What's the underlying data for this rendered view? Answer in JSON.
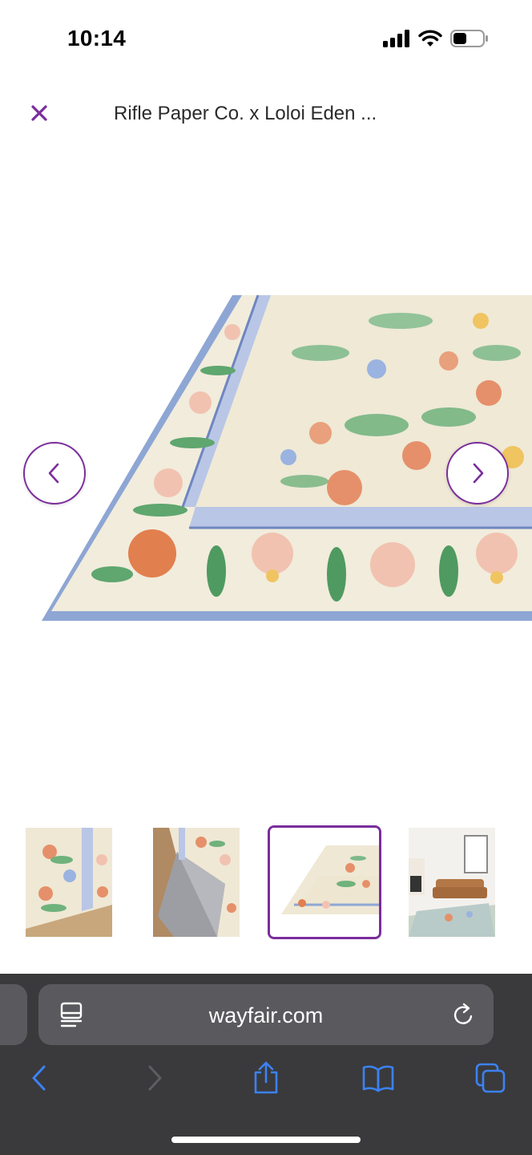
{
  "status_bar": {
    "time": "10:14"
  },
  "header": {
    "title": "Rifle Paper Co. x Loloi Eden ..."
  },
  "gallery": {
    "thumbnails": [
      "rug-top-view",
      "rug-corner-flipped",
      "rug-angled-view",
      "rug-living-room"
    ],
    "selected_index": 2
  },
  "browser": {
    "url": "wayfair.com"
  },
  "colors": {
    "accent": "#7b2d9c",
    "ios_blue": "#3b82f6",
    "toolbar": "#3a3a3c"
  }
}
